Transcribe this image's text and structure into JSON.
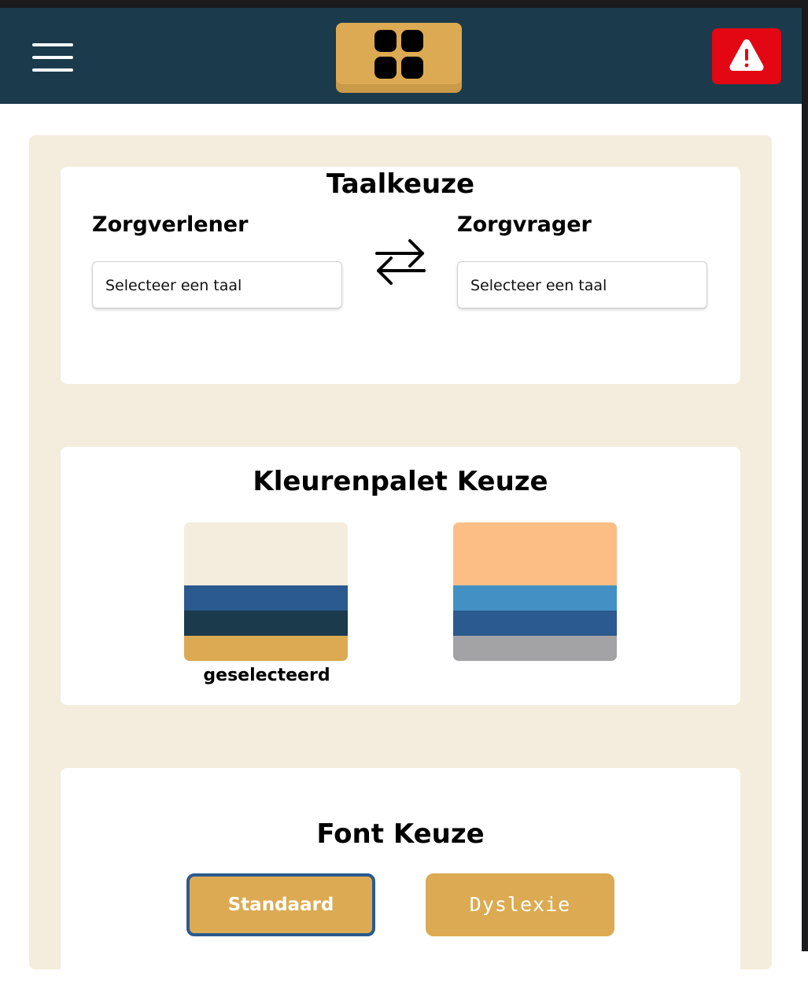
{
  "header": {
    "menu_icon": "hamburger-menu-icon",
    "home_icon": "four-squares-grid-icon",
    "alert_icon": "warning-triangle-icon",
    "brand_color": "#1b3a4c",
    "accent_color": "#dcaa52",
    "alert_color": "#e30613"
  },
  "language": {
    "title": "Taalkeuze",
    "caregiver_label": "Zorgverlener",
    "caregiver_select": "Selecteer een taal",
    "swap_icon": "swap-arrows-icon",
    "client_label": "Zorgvrager",
    "client_select": "Selecteer een taal"
  },
  "palette": {
    "title": "Kleurenpalet Keuze",
    "options": [
      {
        "colors": [
          "#f4ecdc",
          "#2a5a8f",
          "#1b3a4c",
          "#dcaa52"
        ],
        "selected": true,
        "caption": "geselecteerd"
      },
      {
        "colors": [
          "#fdbe86",
          "#4391c4",
          "#2a5a8f",
          "#a3a3a5"
        ],
        "selected": false
      }
    ]
  },
  "font": {
    "title": "Font Keuze",
    "standard_label": "Standaard",
    "dyslexie_label": "Dyslexie",
    "selected": "Standaard"
  }
}
